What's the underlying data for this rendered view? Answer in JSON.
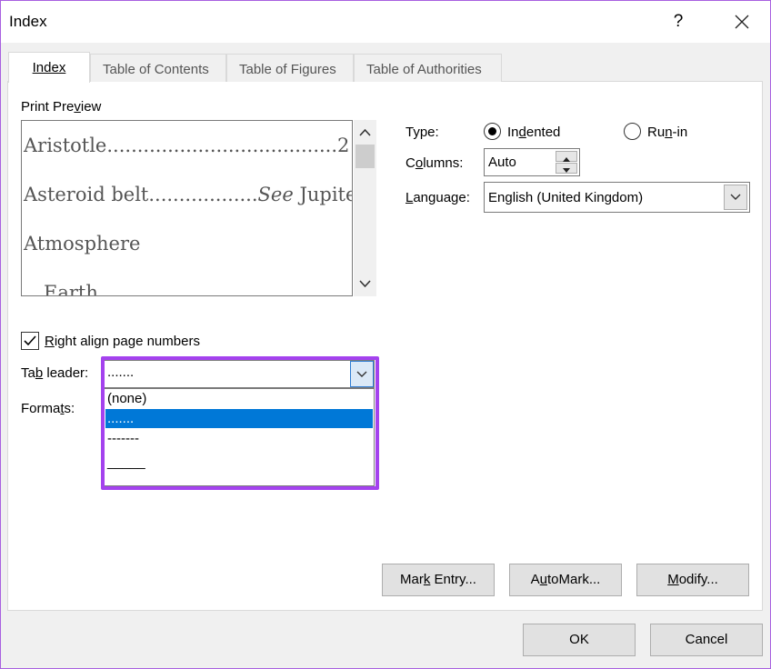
{
  "window": {
    "title": "Index",
    "help_label": "?"
  },
  "tabs": [
    {
      "label": "Index",
      "active": true
    },
    {
      "label": "Table of Contents",
      "active": false
    },
    {
      "label": "Table of Figures",
      "active": false
    },
    {
      "label": "Table of Authorities",
      "active": false
    }
  ],
  "print_preview": {
    "label_pre": "Print Pre",
    "label_ul": "v",
    "label_post": "iew",
    "lines": [
      {
        "text": "Aristotle",
        "dots": "......................................",
        "page": "2"
      },
      {
        "text": "Asteroid belt",
        "dots": "..................",
        "see": "See",
        "target": " Jupiter"
      },
      {
        "text": "Atmosphere"
      },
      {
        "text": "Earth"
      }
    ]
  },
  "right_align": {
    "pre": "",
    "ul": "R",
    "post": "ight align page numbers",
    "checked": true
  },
  "tab_leader": {
    "label_pre": "Ta",
    "label_ul": "b",
    "label_post": " leader:",
    "selected": ".......",
    "options": [
      "(none)",
      ".......",
      "-------",
      "_____"
    ],
    "selected_index": 1
  },
  "formats": {
    "label_pre": "Forma",
    "label_ul": "t",
    "label_post": "s:"
  },
  "type": {
    "label": "Type:",
    "indented": {
      "pre": "In",
      "ul": "d",
      "post": "ented",
      "selected": true
    },
    "run_in": {
      "pre": "Ru",
      "ul": "n",
      "post": "-in",
      "selected": false
    }
  },
  "columns": {
    "label_pre": "C",
    "label_ul": "o",
    "label_post": "lumns:",
    "value": "Auto"
  },
  "language": {
    "label_pre": "",
    "label_ul": "L",
    "label_post": "anguage:",
    "value": "English (United Kingdom)"
  },
  "buttons": {
    "mark_entry": {
      "pre": "Mar",
      "ul": "k",
      "post": " Entry..."
    },
    "automark": {
      "pre": "A",
      "ul": "u",
      "post": "toMark..."
    },
    "modify": {
      "pre": "",
      "ul": "M",
      "post": "odify..."
    },
    "ok": "OK",
    "cancel": "Cancel"
  },
  "colors": {
    "selection": "#0078d7",
    "highlight_border": "#a442ee"
  }
}
